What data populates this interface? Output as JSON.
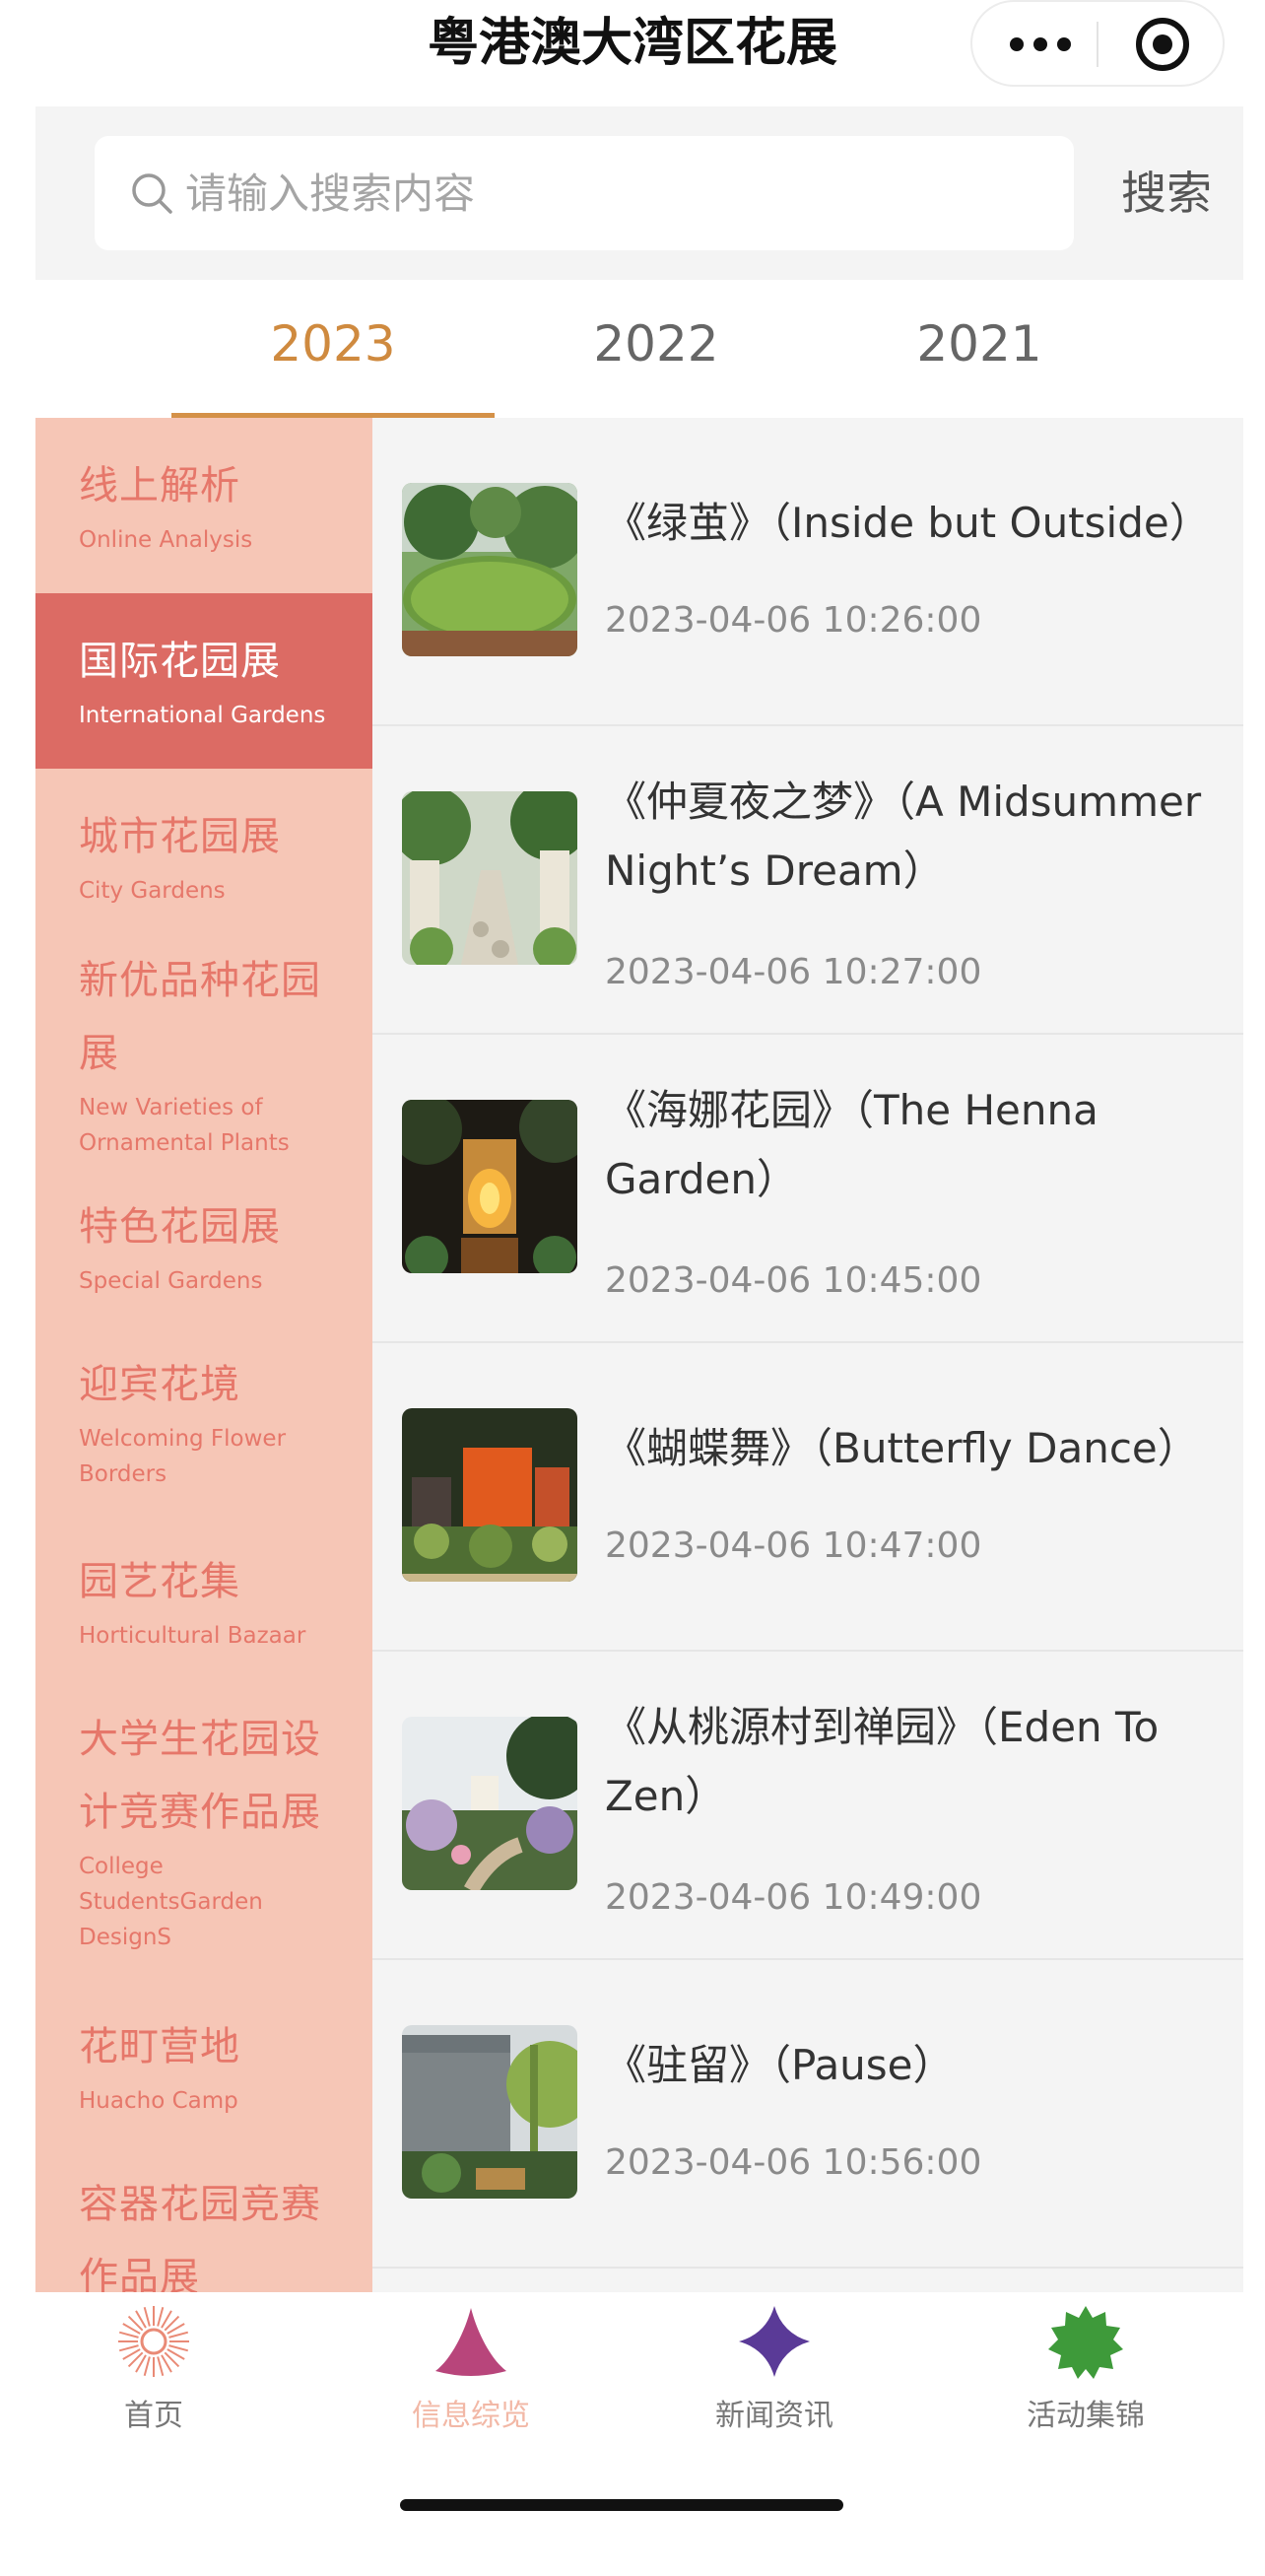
{
  "header": {
    "title": "粤港澳大湾区花展"
  },
  "search": {
    "placeholder": "请输入搜索内容",
    "button_label": "搜索"
  },
  "year_tabs": [
    {
      "label": "2023",
      "active": true
    },
    {
      "label": "2022",
      "active": false
    },
    {
      "label": "2021",
      "active": false
    }
  ],
  "sidebar": {
    "items": [
      {
        "cn": "线上解析",
        "en": "Online Analysis",
        "active": false
      },
      {
        "cn": "国际花园展",
        "en": "International Gardens",
        "active": true
      },
      {
        "cn": "城市花园展",
        "en": "City Gardens",
        "active": false
      },
      {
        "cn": "新优品种花园展",
        "en": "New Varieties of Ornamental Plants",
        "active": false
      },
      {
        "cn": "特色花园展",
        "en": "Special Gardens",
        "active": false
      },
      {
        "cn": "迎宾花境",
        "en": "Welcoming Flower Borders",
        "active": false
      },
      {
        "cn": "园艺花集",
        "en": "Horticultural Bazaar",
        "active": false
      },
      {
        "cn": "大学生花园设计竞赛作品展",
        "en": "College StudentsGarden DesignS",
        "active": false
      },
      {
        "cn": "花町营地",
        "en": "Huacho Camp",
        "active": false
      },
      {
        "cn": "容器花园竞赛作品展",
        "en": "",
        "active": false
      }
    ]
  },
  "list": {
    "items": [
      {
        "title": "《绿茧》（Inside but Outside）",
        "date": "2023-04-06 10:26:00"
      },
      {
        "title": "《仲夏夜之梦》（A Midsummer Night’s Dream）",
        "date": "2023-04-06 10:27:00"
      },
      {
        "title": "《海娜花园》（The Henna Garden）",
        "date": "2023-04-06 10:45:00"
      },
      {
        "title": "《蝴蝶舞》（Butterfly Dance）",
        "date": "2023-04-06 10:47:00"
      },
      {
        "title": "《从桃源村到禅园》（Eden To Zen）",
        "date": "2023-04-06 10:49:00"
      },
      {
        "title": "《驻留》（Pause）",
        "date": "2023-04-06 10:56:00"
      }
    ]
  },
  "tabbar": {
    "items": [
      {
        "label": "首页",
        "icon": "sun-icon",
        "active": false
      },
      {
        "label": "信息综览",
        "icon": "cone-icon",
        "active": true
      },
      {
        "label": "新闻资讯",
        "icon": "star-icon",
        "active": false
      },
      {
        "label": "活动集锦",
        "icon": "badge-icon",
        "active": false
      }
    ]
  },
  "colors": {
    "accent_orange": "#cf8a3f",
    "sidebar_bg": "#f6c6b6",
    "sidebar_active": "#dc6b64",
    "sidebar_text": "#e6776a",
    "tab_home": "#e98a76",
    "tab_info": "#b8457b",
    "tab_news": "#5a3a97",
    "tab_events": "#3e9a3a"
  }
}
